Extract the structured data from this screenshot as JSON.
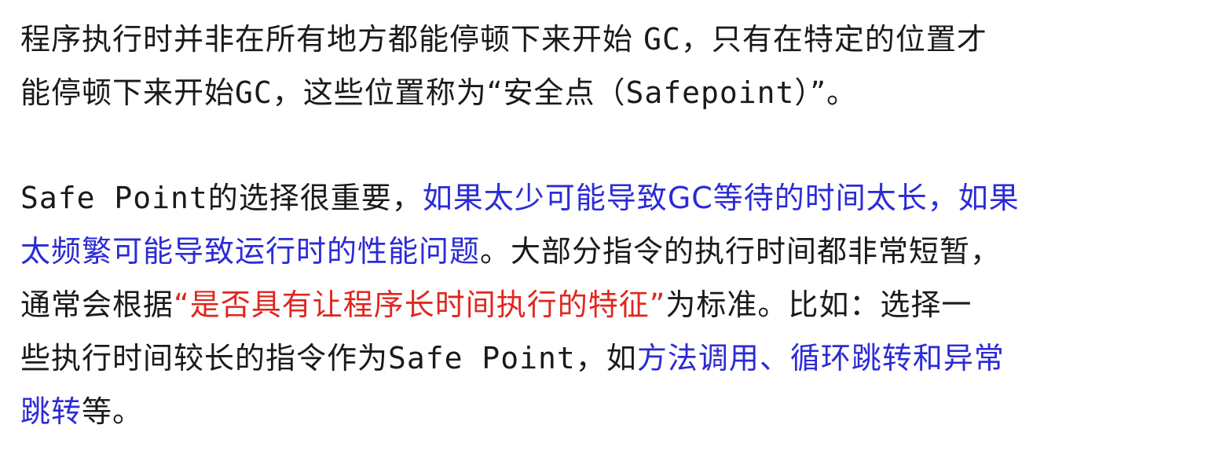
{
  "colors": {
    "text": "#1a1a1a",
    "highlight_blue": "#2b2bd6",
    "highlight_red": "#e0261e",
    "background": "#ffffff"
  },
  "para1": {
    "l1_a": "程序执行时并非在所有地方都能停顿下来开始 ",
    "l1_b": "GC",
    "l1_c": "，只有在特定的位置才",
    "l2_a": "能停顿下来开始",
    "l2_b": "GC",
    "l2_c": "，这些位置称为“安全点（",
    "l2_d": "Safepoint",
    "l2_e": "）”。"
  },
  "para2": {
    "l1_a": "Safe Point",
    "l1_b": "的选择很重要，",
    "l1_c": "如果太少可能导致",
    "l1_d": "GC",
    "l1_e": "等待的时间太长，如果",
    "l2_a": "太频繁可能导致运行时的性能问题",
    "l2_b": "。大部分指令的执行时间都非常短暂，",
    "l3_a": "通常会根据",
    "l3_b": "“是否具有让程序长时间执行的特征”",
    "l3_c": "为标准。比如：选择一",
    "l4_a": "些执行时间较长的指令作为",
    "l4_b": "Safe Point",
    "l4_c": "，如",
    "l4_d": "方法调用、循环跳转和异常",
    "l5_a": "跳转",
    "l5_b": "等。"
  }
}
